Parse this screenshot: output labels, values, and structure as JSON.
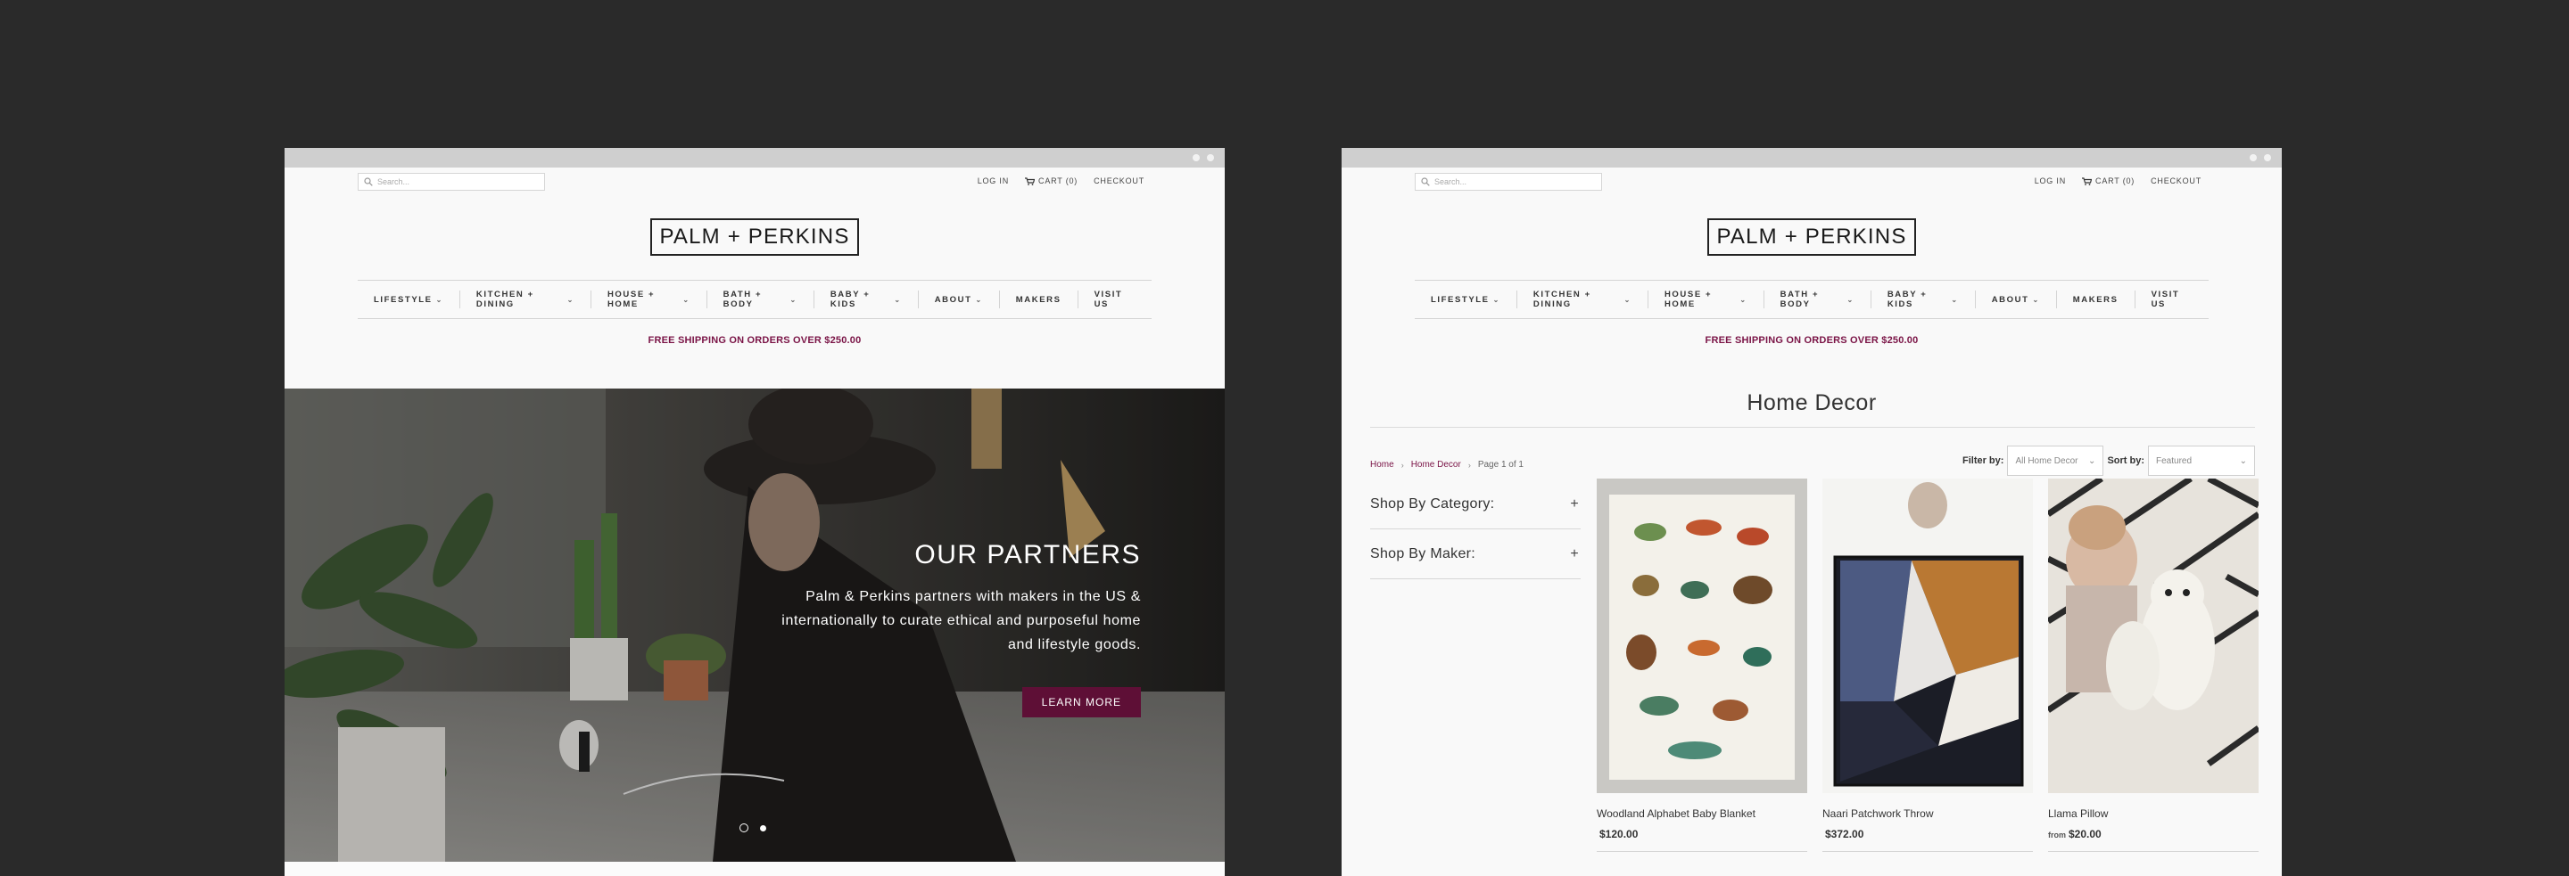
{
  "store": {
    "search_placeholder": "Search...",
    "top_links": [
      "LOG IN",
      "CART (0)",
      "CHECKOUT"
    ],
    "logo": "PALM + PERKINS",
    "nav": [
      {
        "label": "LIFESTYLE",
        "dropdown": true
      },
      {
        "label": "KITCHEN + DINING",
        "dropdown": true
      },
      {
        "label": "HOUSE + HOME",
        "dropdown": true
      },
      {
        "label": "BATH + BODY",
        "dropdown": true
      },
      {
        "label": "BABY + KIDS",
        "dropdown": true
      },
      {
        "label": "ABOUT",
        "dropdown": true
      },
      {
        "label": "MAKERS",
        "dropdown": false
      },
      {
        "label": "VISIT US",
        "dropdown": false
      }
    ],
    "shipping_banner": "FREE SHIPPING ON ORDERS OVER $250.00",
    "colors": {
      "accent": "#7a1446",
      "button": "#5e0f36",
      "background": "#2a2a2a"
    }
  },
  "hero": {
    "title": "OUR PARTNERS",
    "body": "Palm & Perkins partners with makers in the US & internationally to curate ethical and purposeful home and lifestyle goods.",
    "button_label": "LEARN MORE",
    "slides": 2,
    "active_slide": 1
  },
  "collection": {
    "title": "Home Decor",
    "breadcrumb": [
      "Home",
      "Home Decor",
      "Page 1 of 1"
    ],
    "filter_label": "Filter by:",
    "filter_value": "All Home Decor",
    "sort_label": "Sort by:",
    "sort_value": "Featured",
    "sidebar": [
      "Shop By Category:",
      "Shop By Maker:"
    ],
    "products": [
      {
        "name": "Woodland Alphabet Baby Blanket",
        "price": "$120.00",
        "from": ""
      },
      {
        "name": "Naari Patchwork Throw",
        "price": "$372.00",
        "from": ""
      },
      {
        "name": "Llama Pillow",
        "price": "$20.00",
        "from": "from"
      }
    ]
  }
}
